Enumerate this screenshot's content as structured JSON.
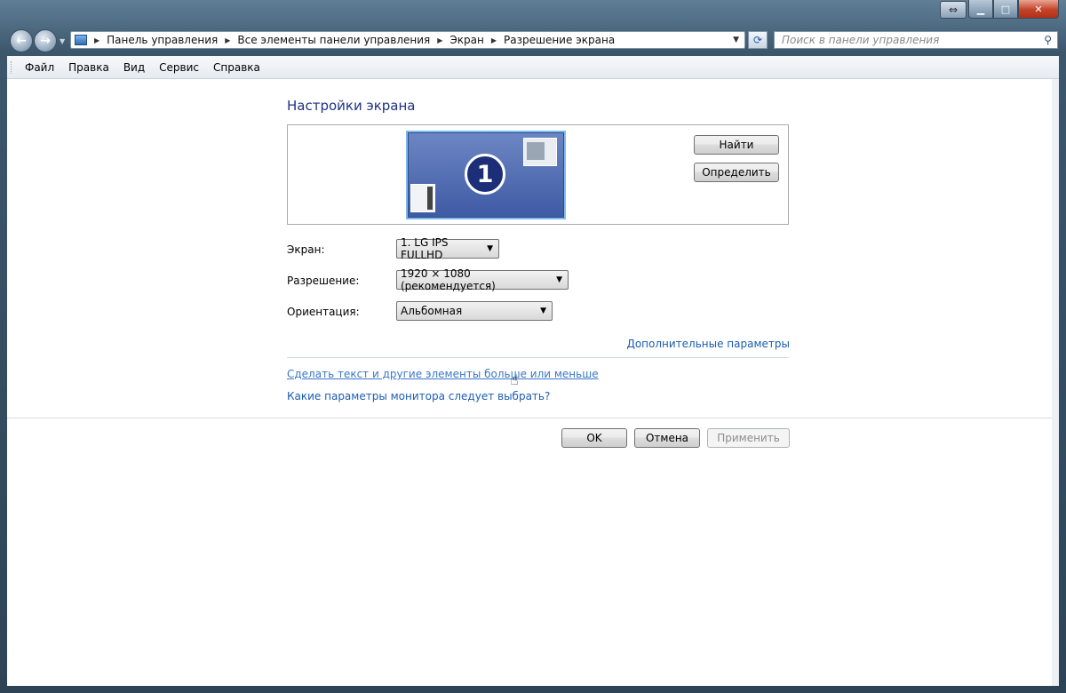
{
  "titlebar": {
    "switch_icon": "⇔",
    "minimize_icon": "▁",
    "maximize_icon": "□",
    "close_icon": "✕"
  },
  "nav": {
    "back_icon": "←",
    "forward_icon": "→",
    "breadcrumb": [
      "Панель управления",
      "Все элементы панели управления",
      "Экран",
      "Разрешение экрана"
    ],
    "search_placeholder": "Поиск в панели управления"
  },
  "menu": [
    "Файл",
    "Правка",
    "Вид",
    "Сервис",
    "Справка"
  ],
  "main": {
    "title": "Настройки экрана",
    "monitor_number": "1",
    "find_button": "Найти",
    "identify_button": "Определить",
    "screen_label": "Экран:",
    "screen_value": "1. LG IPS FULLHD",
    "resolution_label": "Разрешение:",
    "resolution_value": "1920 × 1080 (рекомендуется)",
    "orientation_label": "Ориентация:",
    "orientation_value": "Альбомная",
    "advanced_link": "Дополнительные параметры",
    "text_size_link": "Сделать текст и другие элементы больше или меньше",
    "monitor_help_link": "Какие параметры монитора следует выбрать?"
  },
  "footer": {
    "ok": "OK",
    "cancel": "Отмена",
    "apply": "Применить"
  },
  "colors": {
    "title": "#1e3287",
    "link": "#1a5cb5",
    "close": "#c3432a"
  }
}
